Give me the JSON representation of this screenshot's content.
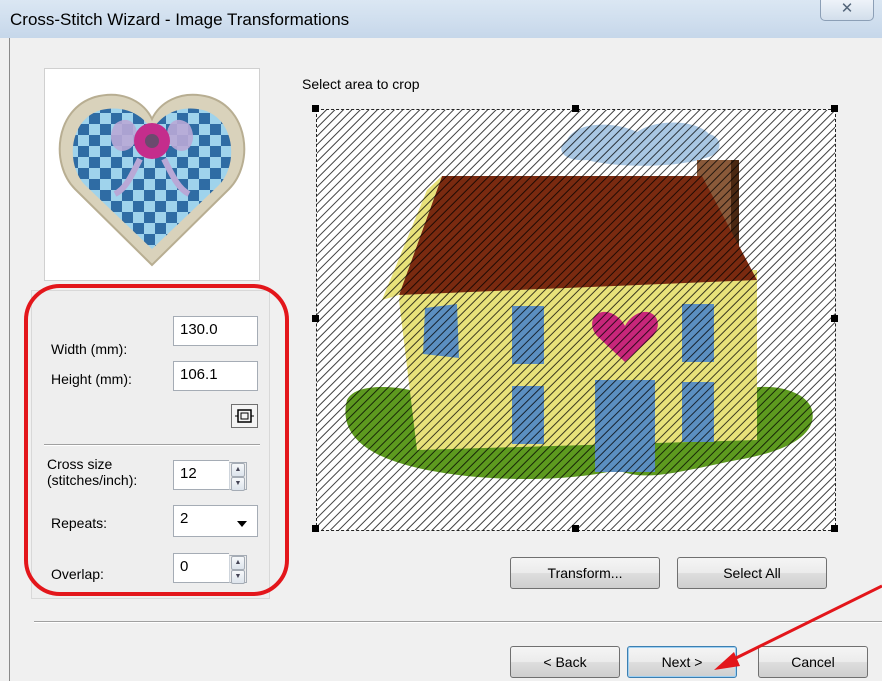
{
  "window": {
    "title": "Cross-Stitch Wizard - Image Transformations",
    "close_glyph": "✕"
  },
  "preview": {
    "icon": "heart-thumbnail-icon"
  },
  "dimensions": {
    "width_label": "Width (mm):",
    "width_value": "130.0",
    "height_label": "Height (mm):",
    "height_value": "106.1",
    "resize_icon": "fit-size-icon"
  },
  "stitch": {
    "cross_size_label_line1": "Cross size",
    "cross_size_label_line2": "(stitches/inch):",
    "cross_size_value": "12",
    "repeats_label": "Repeats:",
    "repeats_value": "2",
    "overlap_label": "Overlap:",
    "overlap_value": "0"
  },
  "crop": {
    "label": "Select area to crop"
  },
  "actions": {
    "transform_label": "Transform...",
    "select_all_label": "Select All"
  },
  "footer": {
    "back_label": "< Back",
    "next_label": "Next >",
    "cancel_label": "Cancel"
  },
  "colors": {
    "highlight": "#e3161b",
    "roof": "#7a2a10",
    "wall": "#e8e27a",
    "window": "#5b8fc1",
    "door": "#5b8fc1",
    "heart": "#c8267a",
    "grass": "#5d9a1f",
    "cloud": "#a9c7e3"
  }
}
